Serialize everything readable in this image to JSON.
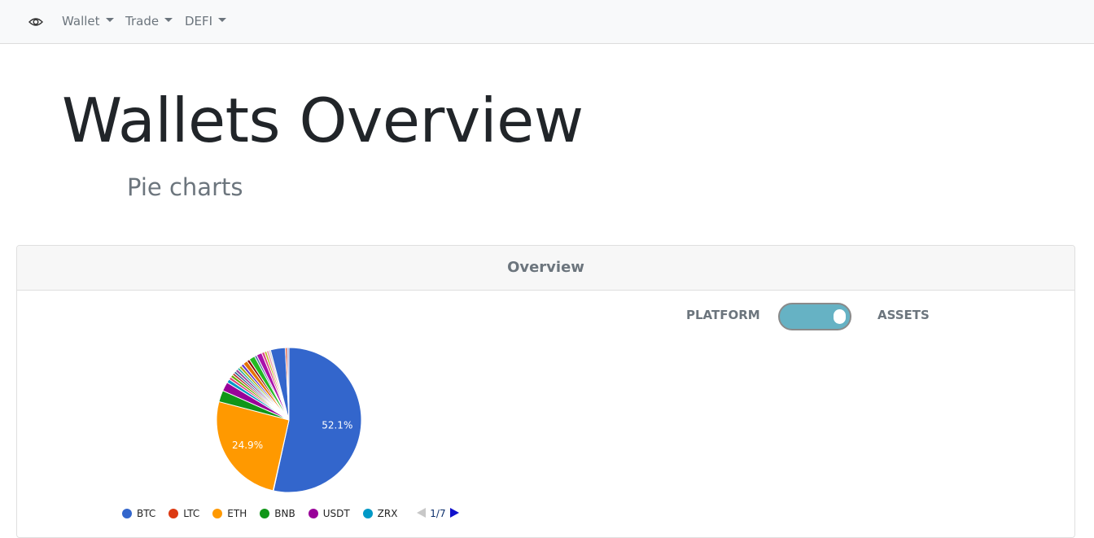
{
  "navbar": {
    "icon": "eye-icon",
    "items": [
      {
        "label": "Wallet"
      },
      {
        "label": "Trade"
      },
      {
        "label": "DEFI"
      }
    ]
  },
  "page": {
    "title": "Wallets Overview",
    "subtitle": "Pie charts"
  },
  "card": {
    "header": "Overview",
    "toggle": {
      "left_label": "PLATFORM",
      "right_label": "ASSETS",
      "state": "assets",
      "track_color": "#66b2c4"
    }
  },
  "chart_data": {
    "type": "pie",
    "slices": [
      {
        "label": "BTC",
        "value": 52.1,
        "color": "#3366cc",
        "data_label": "52.1%"
      },
      {
        "label": "LTC",
        "value": 0.1,
        "color": "#dc3912"
      },
      {
        "label": "ETH",
        "value": 24.9,
        "color": "#ff9900",
        "data_label": "24.9%"
      },
      {
        "label": "BNB",
        "value": 2.5,
        "color": "#109618"
      },
      {
        "label": "USDT",
        "value": 2.0,
        "color": "#990099"
      },
      {
        "label": "ZRX",
        "value": 0.8,
        "color": "#0099c6"
      },
      {
        "label": "",
        "value": 0.6,
        "color": "#dd4477"
      },
      {
        "label": "",
        "value": 0.6,
        "color": "#66aa00"
      },
      {
        "label": "",
        "value": 0.5,
        "color": "#b82e2e"
      },
      {
        "label": "",
        "value": 0.5,
        "color": "#316395"
      },
      {
        "label": "",
        "value": 0.6,
        "color": "#994499"
      },
      {
        "label": "",
        "value": 0.5,
        "color": "#22aa99"
      },
      {
        "label": "",
        "value": 0.6,
        "color": "#aaaa11"
      },
      {
        "label": "",
        "value": 0.6,
        "color": "#6633cc"
      },
      {
        "label": "",
        "value": 1.0,
        "color": "#e67300"
      },
      {
        "label": "",
        "value": 0.6,
        "color": "#8b0707"
      },
      {
        "label": "",
        "value": 1.3,
        "color": "#22bb22"
      },
      {
        "label": "",
        "value": 0.5,
        "color": "#5574a6"
      },
      {
        "label": "",
        "value": 1.2,
        "color": "#aa11aa"
      },
      {
        "label": "",
        "value": 0.6,
        "color": "#dd4488"
      },
      {
        "label": "",
        "value": 0.5,
        "color": "#bbbb22"
      },
      {
        "label": "",
        "value": 0.5,
        "color": "#ee99aa"
      },
      {
        "label": "",
        "value": 0.4,
        "color": "#cccccc"
      },
      {
        "label": "",
        "value": 3.2,
        "color": "#3366cc"
      },
      {
        "label": "",
        "value": 0.4,
        "color": "#dc3912"
      },
      {
        "label": "",
        "value": 0.4,
        "color": "#9999cc"
      }
    ],
    "legend": {
      "entries": [
        "BTC",
        "LTC",
        "ETH",
        "BNB",
        "USDT",
        "ZRX"
      ],
      "page": "1/7",
      "position": "bottom"
    }
  }
}
